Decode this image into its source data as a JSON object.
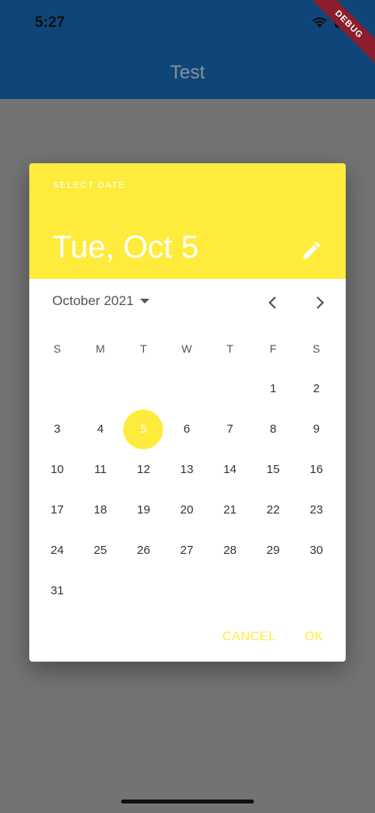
{
  "status_bar": {
    "time": "5:27",
    "signal_dots": "····"
  },
  "app_bar": {
    "title": "Test"
  },
  "debug_banner": {
    "label": "DEBUG"
  },
  "dialog": {
    "help_text": "SELECT DATE",
    "selected_date": "Tue, Oct 5",
    "edit_icon": "pencil-icon",
    "month_label": "October 2021",
    "weekdays": [
      "S",
      "M",
      "T",
      "W",
      "T",
      "F",
      "S"
    ],
    "selected_day": "5",
    "days": [
      "",
      "",
      "",
      "",
      "",
      "1",
      "2",
      "3",
      "4",
      "5",
      "6",
      "7",
      "8",
      "9",
      "10",
      "11",
      "12",
      "13",
      "14",
      "15",
      "16",
      "17",
      "18",
      "19",
      "20",
      "21",
      "22",
      "23",
      "24",
      "25",
      "26",
      "27",
      "28",
      "29",
      "30",
      "31",
      "",
      "",
      "",
      "",
      "",
      ""
    ],
    "cancel_label": "CANCEL",
    "ok_label": "OK"
  },
  "colors": {
    "accent": "#ffeb3b",
    "app_bar": "#0f4679",
    "scrim_background": "#737373"
  }
}
